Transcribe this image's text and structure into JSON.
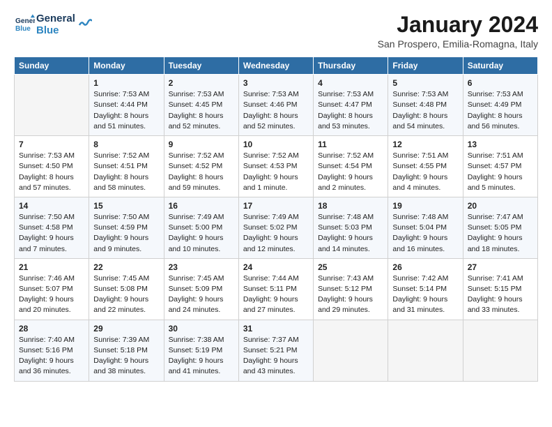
{
  "logo": {
    "line1": "General",
    "line2": "Blue"
  },
  "title": "January 2024",
  "location": "San Prospero, Emilia-Romagna, Italy",
  "weekdays": [
    "Sunday",
    "Monday",
    "Tuesday",
    "Wednesday",
    "Thursday",
    "Friday",
    "Saturday"
  ],
  "weeks": [
    [
      {
        "day": "",
        "sunrise": "",
        "sunset": "",
        "daylight": ""
      },
      {
        "day": "1",
        "sunrise": "Sunrise: 7:53 AM",
        "sunset": "Sunset: 4:44 PM",
        "daylight": "Daylight: 8 hours and 51 minutes."
      },
      {
        "day": "2",
        "sunrise": "Sunrise: 7:53 AM",
        "sunset": "Sunset: 4:45 PM",
        "daylight": "Daylight: 8 hours and 52 minutes."
      },
      {
        "day": "3",
        "sunrise": "Sunrise: 7:53 AM",
        "sunset": "Sunset: 4:46 PM",
        "daylight": "Daylight: 8 hours and 52 minutes."
      },
      {
        "day": "4",
        "sunrise": "Sunrise: 7:53 AM",
        "sunset": "Sunset: 4:47 PM",
        "daylight": "Daylight: 8 hours and 53 minutes."
      },
      {
        "day": "5",
        "sunrise": "Sunrise: 7:53 AM",
        "sunset": "Sunset: 4:48 PM",
        "daylight": "Daylight: 8 hours and 54 minutes."
      },
      {
        "day": "6",
        "sunrise": "Sunrise: 7:53 AM",
        "sunset": "Sunset: 4:49 PM",
        "daylight": "Daylight: 8 hours and 56 minutes."
      }
    ],
    [
      {
        "day": "7",
        "sunrise": "Sunrise: 7:53 AM",
        "sunset": "Sunset: 4:50 PM",
        "daylight": "Daylight: 8 hours and 57 minutes."
      },
      {
        "day": "8",
        "sunrise": "Sunrise: 7:52 AM",
        "sunset": "Sunset: 4:51 PM",
        "daylight": "Daylight: 8 hours and 58 minutes."
      },
      {
        "day": "9",
        "sunrise": "Sunrise: 7:52 AM",
        "sunset": "Sunset: 4:52 PM",
        "daylight": "Daylight: 8 hours and 59 minutes."
      },
      {
        "day": "10",
        "sunrise": "Sunrise: 7:52 AM",
        "sunset": "Sunset: 4:53 PM",
        "daylight": "Daylight: 9 hours and 1 minute."
      },
      {
        "day": "11",
        "sunrise": "Sunrise: 7:52 AM",
        "sunset": "Sunset: 4:54 PM",
        "daylight": "Daylight: 9 hours and 2 minutes."
      },
      {
        "day": "12",
        "sunrise": "Sunrise: 7:51 AM",
        "sunset": "Sunset: 4:55 PM",
        "daylight": "Daylight: 9 hours and 4 minutes."
      },
      {
        "day": "13",
        "sunrise": "Sunrise: 7:51 AM",
        "sunset": "Sunset: 4:57 PM",
        "daylight": "Daylight: 9 hours and 5 minutes."
      }
    ],
    [
      {
        "day": "14",
        "sunrise": "Sunrise: 7:50 AM",
        "sunset": "Sunset: 4:58 PM",
        "daylight": "Daylight: 9 hours and 7 minutes."
      },
      {
        "day": "15",
        "sunrise": "Sunrise: 7:50 AM",
        "sunset": "Sunset: 4:59 PM",
        "daylight": "Daylight: 9 hours and 9 minutes."
      },
      {
        "day": "16",
        "sunrise": "Sunrise: 7:49 AM",
        "sunset": "Sunset: 5:00 PM",
        "daylight": "Daylight: 9 hours and 10 minutes."
      },
      {
        "day": "17",
        "sunrise": "Sunrise: 7:49 AM",
        "sunset": "Sunset: 5:02 PM",
        "daylight": "Daylight: 9 hours and 12 minutes."
      },
      {
        "day": "18",
        "sunrise": "Sunrise: 7:48 AM",
        "sunset": "Sunset: 5:03 PM",
        "daylight": "Daylight: 9 hours and 14 minutes."
      },
      {
        "day": "19",
        "sunrise": "Sunrise: 7:48 AM",
        "sunset": "Sunset: 5:04 PM",
        "daylight": "Daylight: 9 hours and 16 minutes."
      },
      {
        "day": "20",
        "sunrise": "Sunrise: 7:47 AM",
        "sunset": "Sunset: 5:05 PM",
        "daylight": "Daylight: 9 hours and 18 minutes."
      }
    ],
    [
      {
        "day": "21",
        "sunrise": "Sunrise: 7:46 AM",
        "sunset": "Sunset: 5:07 PM",
        "daylight": "Daylight: 9 hours and 20 minutes."
      },
      {
        "day": "22",
        "sunrise": "Sunrise: 7:45 AM",
        "sunset": "Sunset: 5:08 PM",
        "daylight": "Daylight: 9 hours and 22 minutes."
      },
      {
        "day": "23",
        "sunrise": "Sunrise: 7:45 AM",
        "sunset": "Sunset: 5:09 PM",
        "daylight": "Daylight: 9 hours and 24 minutes."
      },
      {
        "day": "24",
        "sunrise": "Sunrise: 7:44 AM",
        "sunset": "Sunset: 5:11 PM",
        "daylight": "Daylight: 9 hours and 27 minutes."
      },
      {
        "day": "25",
        "sunrise": "Sunrise: 7:43 AM",
        "sunset": "Sunset: 5:12 PM",
        "daylight": "Daylight: 9 hours and 29 minutes."
      },
      {
        "day": "26",
        "sunrise": "Sunrise: 7:42 AM",
        "sunset": "Sunset: 5:14 PM",
        "daylight": "Daylight: 9 hours and 31 minutes."
      },
      {
        "day": "27",
        "sunrise": "Sunrise: 7:41 AM",
        "sunset": "Sunset: 5:15 PM",
        "daylight": "Daylight: 9 hours and 33 minutes."
      }
    ],
    [
      {
        "day": "28",
        "sunrise": "Sunrise: 7:40 AM",
        "sunset": "Sunset: 5:16 PM",
        "daylight": "Daylight: 9 hours and 36 minutes."
      },
      {
        "day": "29",
        "sunrise": "Sunrise: 7:39 AM",
        "sunset": "Sunset: 5:18 PM",
        "daylight": "Daylight: 9 hours and 38 minutes."
      },
      {
        "day": "30",
        "sunrise": "Sunrise: 7:38 AM",
        "sunset": "Sunset: 5:19 PM",
        "daylight": "Daylight: 9 hours and 41 minutes."
      },
      {
        "day": "31",
        "sunrise": "Sunrise: 7:37 AM",
        "sunset": "Sunset: 5:21 PM",
        "daylight": "Daylight: 9 hours and 43 minutes."
      },
      {
        "day": "",
        "sunrise": "",
        "sunset": "",
        "daylight": ""
      },
      {
        "day": "",
        "sunrise": "",
        "sunset": "",
        "daylight": ""
      },
      {
        "day": "",
        "sunrise": "",
        "sunset": "",
        "daylight": ""
      }
    ]
  ]
}
